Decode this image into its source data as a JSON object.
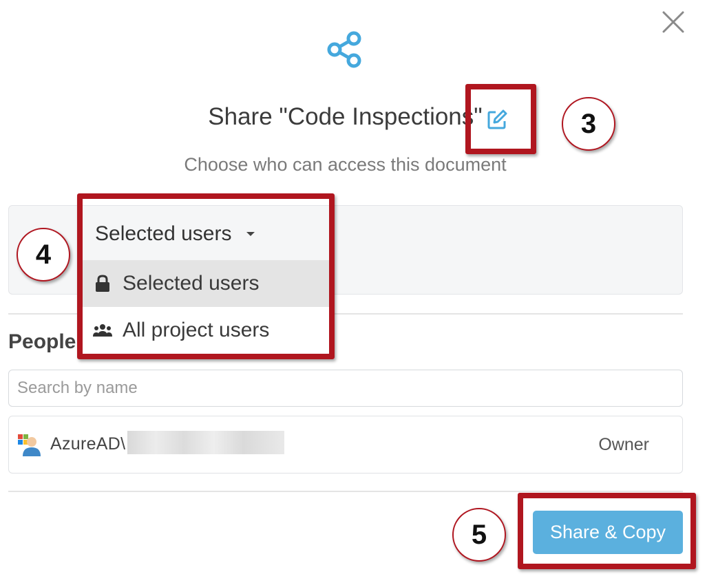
{
  "dialog": {
    "title": "Share \"Code Inspections\"",
    "subtitle": "Choose who can access this document"
  },
  "access": {
    "selected_label": "Selected users",
    "options": [
      {
        "label": "Selected users",
        "icon": "lock-icon",
        "selected": true
      },
      {
        "label": "All project users",
        "icon": "group-icon",
        "selected": false
      }
    ]
  },
  "people": {
    "label": "People",
    "search_placeholder": "Search by name",
    "users": [
      {
        "name": "AzureAD\\",
        "role": "Owner",
        "icon": "user-avatar-icon"
      }
    ]
  },
  "footer": {
    "primary_button": "Share & Copy"
  },
  "annotations": {
    "step_3": "3",
    "step_4": "4",
    "step_5": "5"
  },
  "colors": {
    "accent": "#5bb0de",
    "highlight": "#b0161f"
  }
}
